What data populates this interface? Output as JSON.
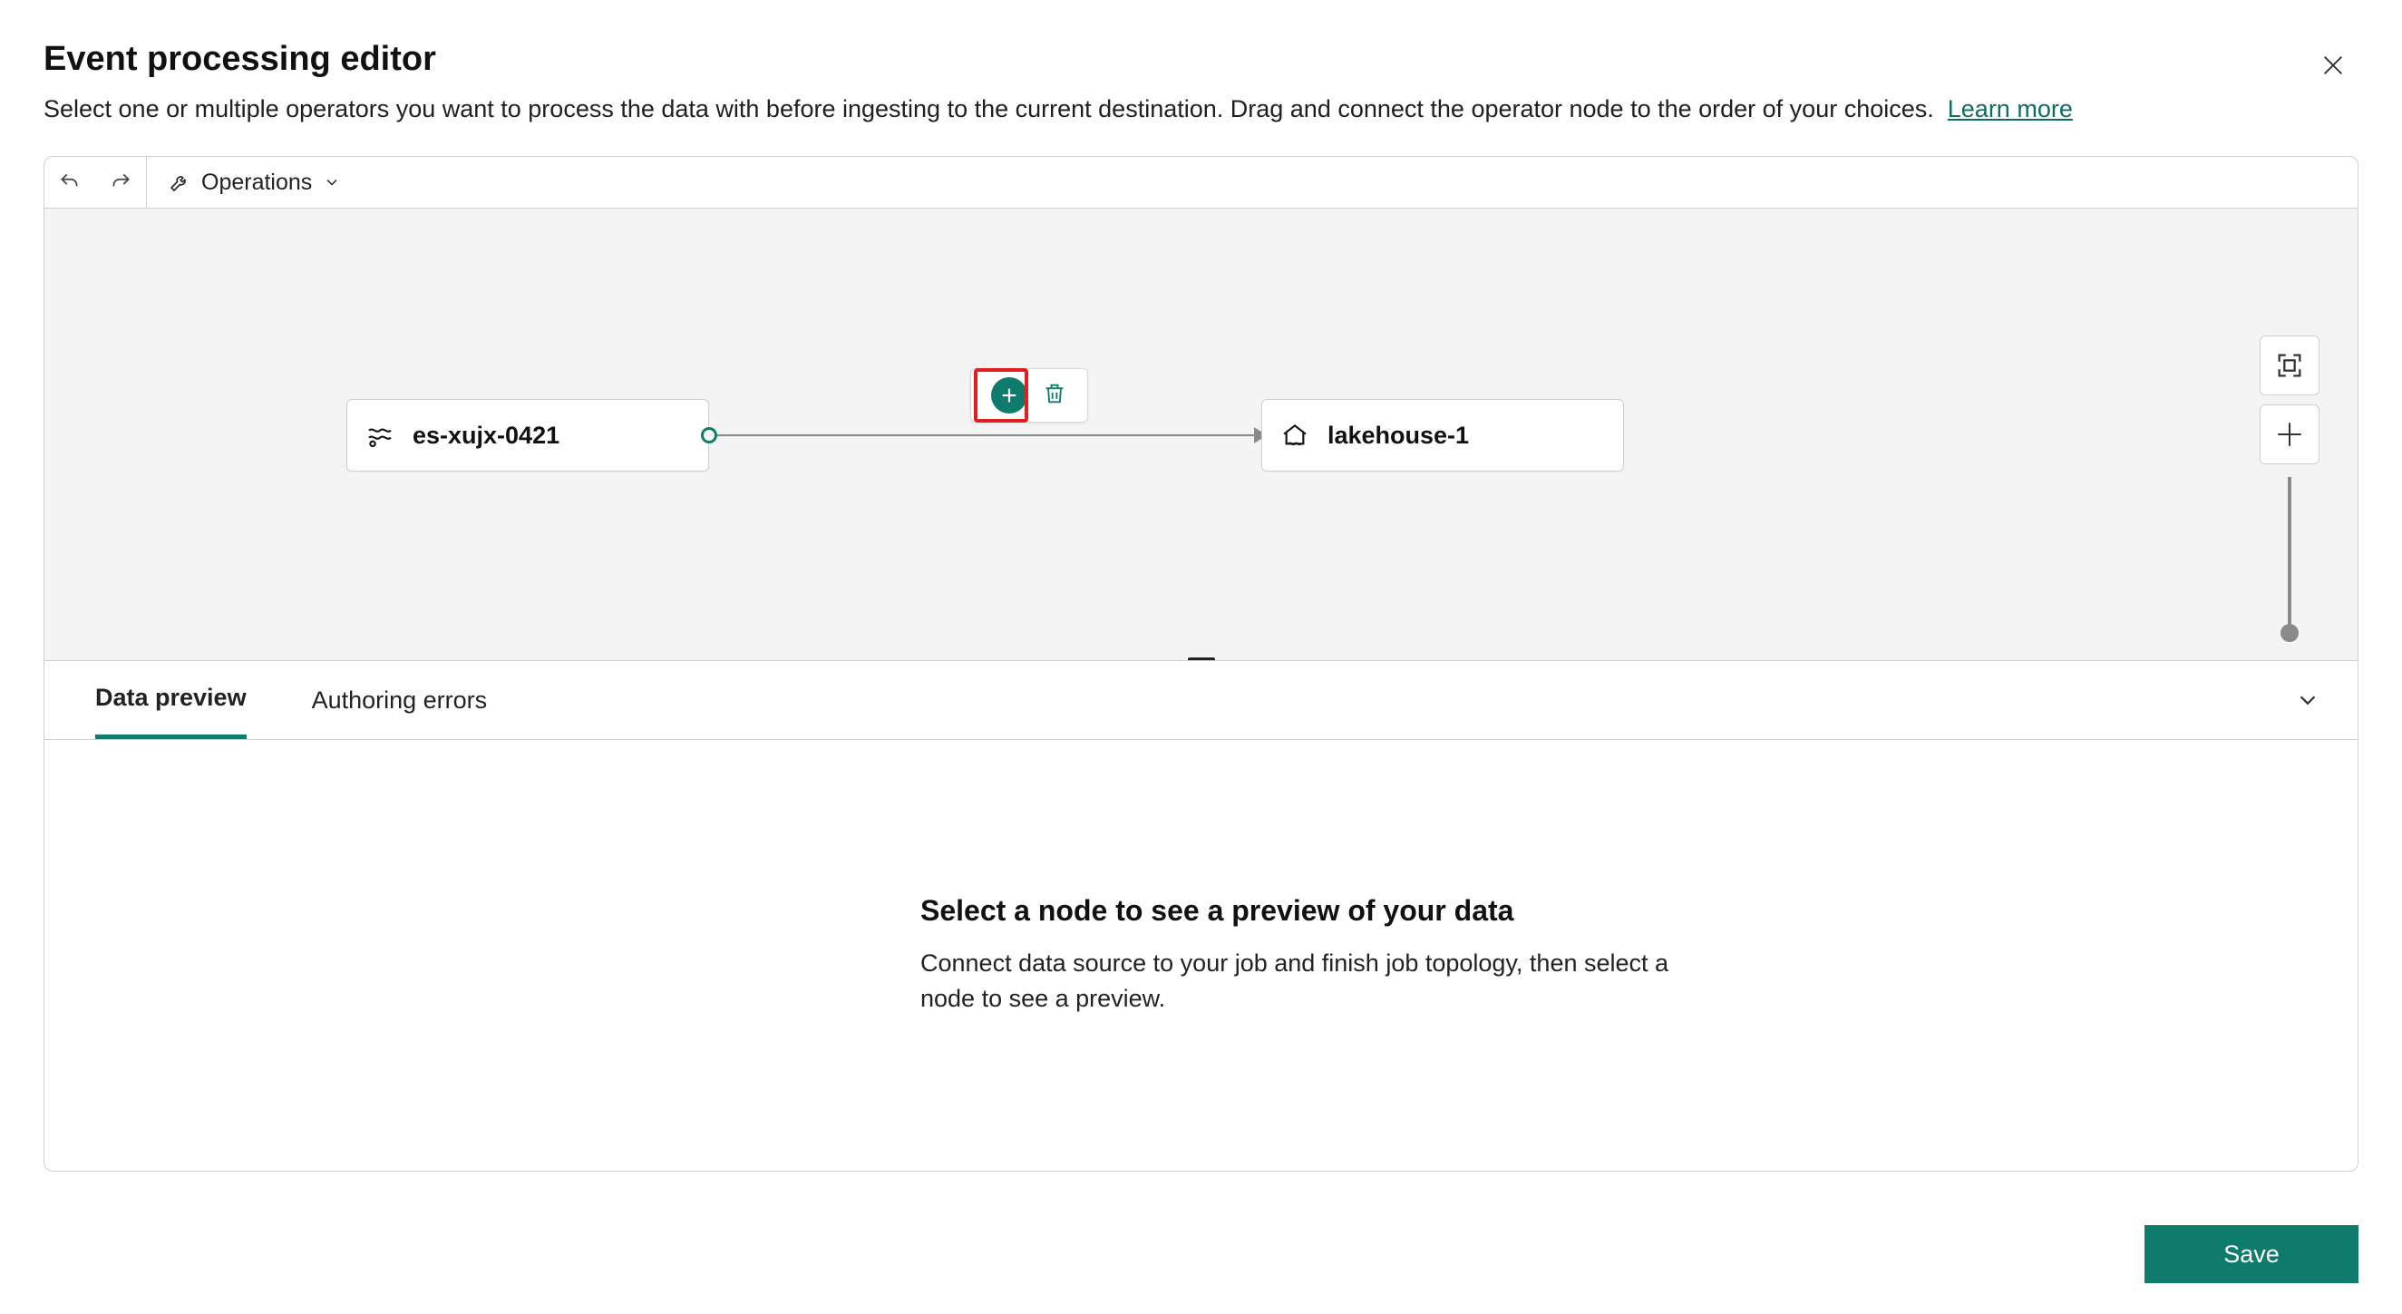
{
  "header": {
    "title": "Event processing editor",
    "subtitle": "Select one or multiple operators you want to process the data with before ingesting to the current destination. Drag and connect the operator node to the order of your choices.",
    "learn_more": "Learn more"
  },
  "toolbar": {
    "operations_label": "Operations"
  },
  "canvas": {
    "source_node": {
      "label": "es-xujx-0421"
    },
    "dest_node": {
      "label": "lakehouse-1"
    }
  },
  "tabs": {
    "data_preview": "Data preview",
    "authoring_errors": "Authoring errors"
  },
  "preview_panel": {
    "heading": "Select a node to see a preview of your data",
    "body": "Connect data source to your job and finish job topology, then select a node to see a preview."
  },
  "footer": {
    "save_label": "Save"
  }
}
